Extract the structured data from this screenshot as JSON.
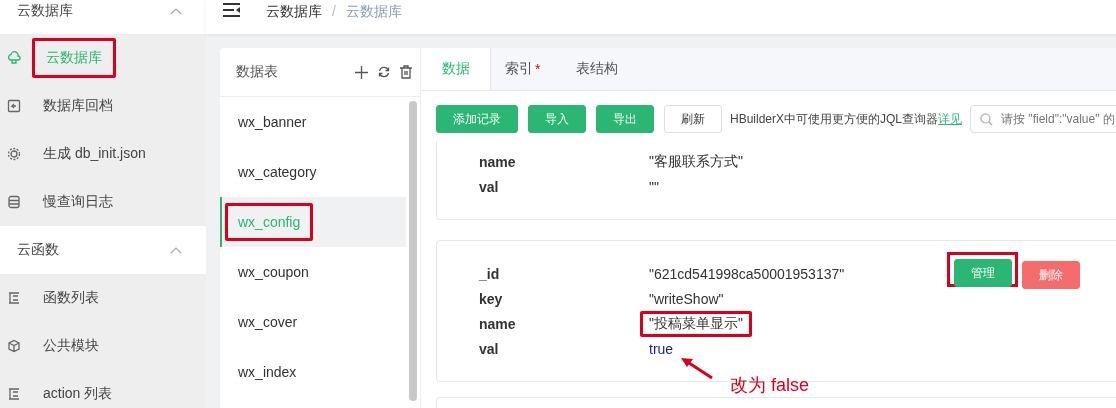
{
  "sidebar": {
    "sections": [
      {
        "title": "云数据库",
        "expanded": true,
        "items": [
          {
            "label": "云数据库",
            "kind": "cloud",
            "selected": true,
            "highlighted": true
          },
          {
            "label": "数据库回档",
            "kind": "history",
            "selected": false,
            "highlighted": false
          },
          {
            "label": "生成 db_init.json",
            "kind": "gear",
            "selected": false,
            "highlighted": false
          },
          {
            "label": "慢查询日志",
            "kind": "database",
            "selected": false,
            "highlighted": false
          }
        ]
      },
      {
        "title": "云函数",
        "expanded": true,
        "items": [
          {
            "label": "函数列表",
            "kind": "list",
            "selected": false,
            "highlighted": false
          },
          {
            "label": "公共模块",
            "kind": "cube",
            "selected": false,
            "highlighted": false
          },
          {
            "label": "action 列表",
            "kind": "list",
            "selected": false,
            "highlighted": false
          }
        ]
      }
    ]
  },
  "breadcrumb": {
    "items": [
      "云数据库",
      "云数据库"
    ],
    "separator": "/"
  },
  "tables": {
    "title": "数据表",
    "items": [
      {
        "label": "wx_banner",
        "selected": false,
        "highlighted": false
      },
      {
        "label": "wx_category",
        "selected": false,
        "highlighted": false
      },
      {
        "label": "wx_config",
        "selected": true,
        "highlighted": true
      },
      {
        "label": "wx_coupon",
        "selected": false,
        "highlighted": false
      },
      {
        "label": "wx_cover",
        "selected": false,
        "highlighted": false
      },
      {
        "label": "wx_index",
        "selected": false,
        "highlighted": false
      }
    ]
  },
  "tabs": [
    {
      "label": "数据",
      "selected": true
    },
    {
      "label": "索引",
      "selected": false,
      "badge": "*"
    },
    {
      "label": "表结构",
      "selected": false
    }
  ],
  "toolbar": {
    "buttons": [
      {
        "label": "添加记录",
        "kind": "primary"
      },
      {
        "label": "导入",
        "kind": "primary"
      },
      {
        "label": "导出",
        "kind": "primary"
      },
      {
        "label": "刷新",
        "kind": "plain"
      }
    ],
    "hint": "HBuilderX中可使用更方便的JQL查询器",
    "link": "详见",
    "search": {
      "placeholder": "请按 \"field\":\"value\" 的"
    }
  },
  "records": [
    {
      "fields": [
        {
          "key": "name",
          "value": "\"客服联系方式\"",
          "kind": "string",
          "highlighted": false
        },
        {
          "key": "val",
          "value": "\"\"",
          "kind": "string",
          "highlighted": false
        }
      ]
    },
    {
      "fields": [
        {
          "key": "_id",
          "value": "\"621cd541998ca50001953137\"",
          "kind": "string",
          "highlighted": false
        },
        {
          "key": "key",
          "value": "\"writeShow\"",
          "kind": "string",
          "highlighted": false
        },
        {
          "key": "name",
          "value": "\"投稿菜单显示\"",
          "kind": "string",
          "highlighted": true
        },
        {
          "key": "val",
          "value": "true",
          "kind": "boolean",
          "highlighted": false
        }
      ],
      "actions": [
        {
          "label": "管理",
          "kind": "primary",
          "highlighted": true
        },
        {
          "label": "删除",
          "kind": "danger",
          "highlighted": false
        }
      ]
    }
  ],
  "annotation": "改为 false"
}
